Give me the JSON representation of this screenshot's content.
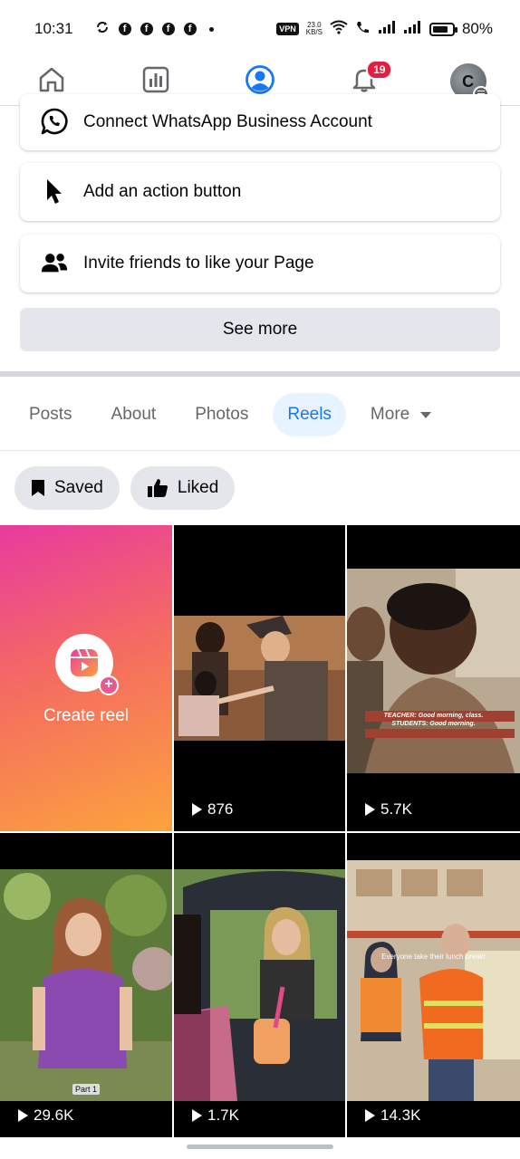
{
  "status_bar": {
    "time": "10:31",
    "vpn": "VPN",
    "speed_value": "23.0",
    "speed_unit": "KB/S",
    "battery": "80%",
    "battery_level": 0.8
  },
  "nav": {
    "items": [
      {
        "name": "home-icon",
        "active": false
      },
      {
        "name": "dashboard-icon",
        "active": false
      },
      {
        "name": "profile-icon",
        "active": true
      },
      {
        "name": "bell-icon",
        "active": false,
        "badge": "19"
      },
      {
        "name": "avatar",
        "active": false,
        "initial": "C"
      }
    ]
  },
  "actions": {
    "whatsapp": "Connect WhatsApp Business Account",
    "action_button": "Add an action button",
    "invite": "Invite friends to like your Page",
    "see_more": "See more"
  },
  "tabs": {
    "items": [
      "Posts",
      "About",
      "Photos",
      "Reels",
      "More"
    ],
    "active": "Reels"
  },
  "chips": {
    "saved": "Saved",
    "liked": "Liked"
  },
  "reels": {
    "create_label": "Create reel",
    "items": [
      {
        "views": "876"
      },
      {
        "views": "5.7K",
        "caption_1": "TEACHER: Good morning, class.",
        "caption_2": "STUDENTS: Good morning."
      },
      {
        "views": "29.6K",
        "tag": "Part 1"
      },
      {
        "views": "1.7K"
      },
      {
        "views": "14.3K",
        "caption": "Everyone take their lunch break!"
      }
    ]
  },
  "colors": {
    "accent": "#1877f2",
    "badge": "#e41e3f",
    "chip_bg": "#e4e6eb"
  }
}
